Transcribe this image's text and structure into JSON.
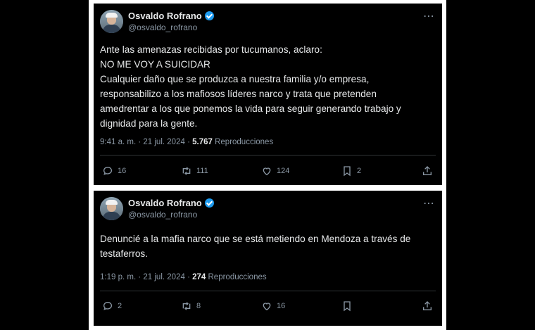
{
  "tweets": [
    {
      "author_name": "Osvaldo Rofrano",
      "author_handle": "@osvaldo_rofrano",
      "lines": [
        "Ante las amenazas recibidas por tucumanos, aclaro:",
        "NO ME VOY A SUICIDAR",
        "Cualquier daño que se produzca a nuestra familia y/o empresa,",
        "responsabilizo a los mafiosos líderes narco y trata que pretenden",
        "amedrentar a los que ponemos la vida para seguir generando trabajo y",
        "dignidad para la gente."
      ],
      "time": "9:41 a. m.",
      "date": "21 jul. 2024",
      "views": "5.767",
      "views_label": "Reproducciones",
      "replies": "16",
      "retweets": "111",
      "likes": "124",
      "bookmarks": "2"
    },
    {
      "author_name": "Osvaldo Rofrano",
      "author_handle": "@osvaldo_rofrano",
      "lines": [
        "Denuncié a la mafia narco que se está metiendo en Mendoza a través de",
        "testaferros."
      ],
      "time": "1:19 p. m.",
      "date": "21 jul. 2024",
      "views": "274",
      "views_label": "Reproducciones",
      "replies": "2",
      "retweets": "8",
      "likes": "16",
      "bookmarks": ""
    }
  ],
  "separator": "·",
  "colors": {
    "accent": "#1d9bf0",
    "muted": "#8b98a5",
    "text": "#e7e9ea",
    "background": "#000000"
  },
  "icons": [
    "avatar",
    "verified-badge-icon",
    "more-icon",
    "reply-icon",
    "retweet-icon",
    "like-icon",
    "bookmark-icon",
    "share-icon"
  ]
}
